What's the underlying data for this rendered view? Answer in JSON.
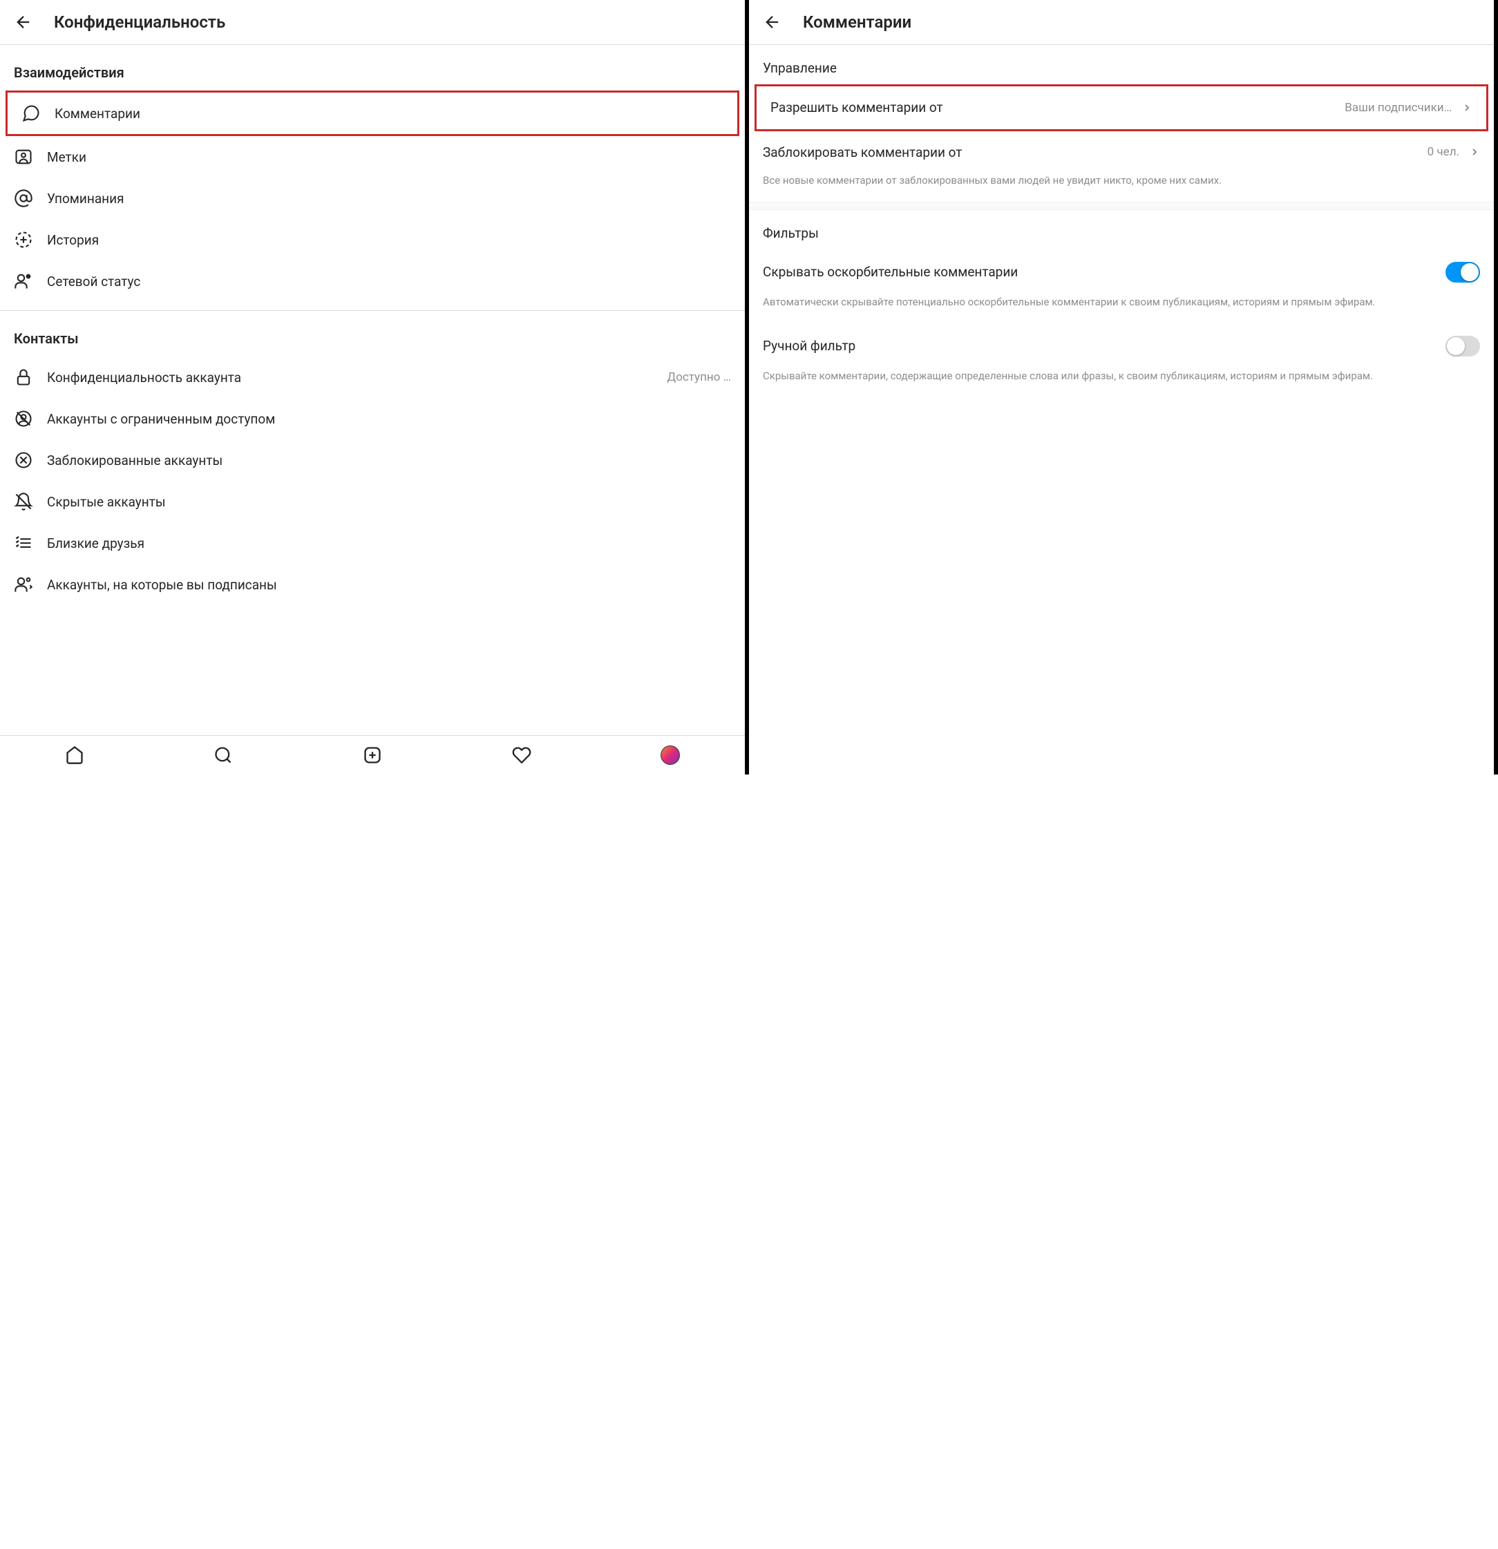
{
  "left": {
    "header_title": "Конфиденциальность",
    "section1_title": "Взаимодействия",
    "items1": [
      {
        "label": "Комментарии"
      },
      {
        "label": "Метки"
      },
      {
        "label": "Упоминания"
      },
      {
        "label": "История"
      },
      {
        "label": "Сетевой статус"
      }
    ],
    "section2_title": "Контакты",
    "items2": [
      {
        "label": "Конфиденциальность аккаунта",
        "secondary": "Доступно …"
      },
      {
        "label": "Аккаунты с ограниченным доступом"
      },
      {
        "label": "Заблокированные аккаунты"
      },
      {
        "label": "Скрытые аккаунты"
      },
      {
        "label": "Близкие друзья"
      },
      {
        "label": "Аккаунты, на которые вы подписаны"
      }
    ]
  },
  "right": {
    "header_title": "Комментарии",
    "section1_title": "Управление",
    "allow_from_label": "Разрешить комментарии от",
    "allow_from_value": "Ваши подписчики…",
    "block_from_label": "Заблокировать комментарии от",
    "block_from_value": "0 чел.",
    "block_desc": "Все новые комментарии от заблокированных вами людей не увидит никто, кроме них самих.",
    "section2_title": "Фильтры",
    "hide_offensive_label": "Скрывать оскорбительные комментарии",
    "hide_offensive_desc": "Автоматически скрывайте потенциально оскорбительные комментарии к своим публикациям, историям и прямым эфирам.",
    "manual_filter_label": "Ручной фильтр",
    "manual_filter_desc": "Скрывайте комментарии, содержащие определенные слова или фразы, к своим публикациям, историям и прямым эфирам."
  }
}
